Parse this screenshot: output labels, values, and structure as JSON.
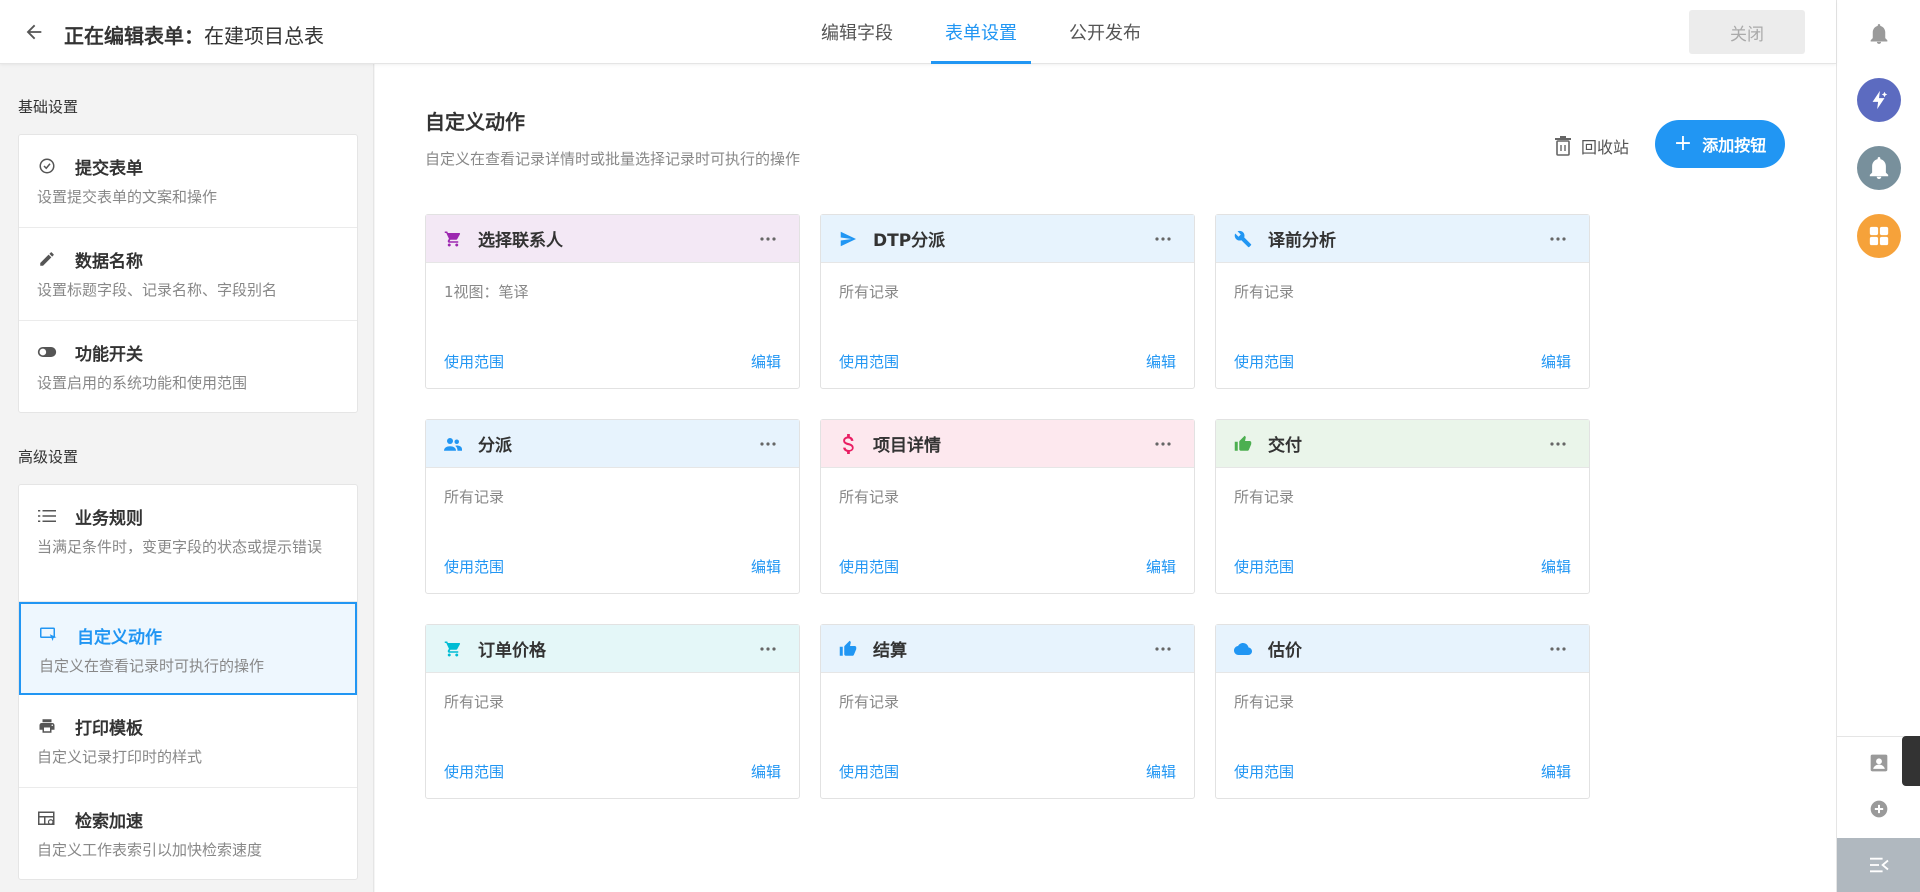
{
  "header": {
    "title_prefix": "正在编辑表单：",
    "title_name": "在建项目总表",
    "tabs": [
      {
        "label": "编辑字段"
      },
      {
        "label": "表单设置",
        "active": true
      },
      {
        "label": "公开发布"
      }
    ],
    "close_label": "关闭"
  },
  "sidebar": {
    "basic_title": "基础设置",
    "basic_items": [
      {
        "title": "提交表单",
        "desc": "设置提交表单的文案和操作",
        "icon": "check-circle-icon"
      },
      {
        "title": "数据名称",
        "desc": "设置标题字段、记录名称、字段别名",
        "icon": "pencil-icon"
      },
      {
        "title": "功能开关",
        "desc": "设置启用的系统功能和使用范围",
        "icon": "toggle-icon"
      }
    ],
    "advanced_title": "高级设置",
    "advanced_items": [
      {
        "title": "业务规则",
        "desc": "当满足条件时，变更字段的状态或提示错误",
        "icon": "list-icon"
      },
      {
        "title": "自定义动作",
        "desc": "自定义在查看记录时可执行的操作",
        "icon": "custom-action-icon",
        "selected": true
      },
      {
        "title": "打印模板",
        "desc": "自定义记录打印时的样式",
        "icon": "printer-icon"
      },
      {
        "title": "检索加速",
        "desc": "自定义工作表索引以加快检索速度",
        "icon": "index-icon"
      }
    ]
  },
  "main": {
    "title": "自定义动作",
    "desc": "自定义在查看记录详情时或批量选择记录时可执行的操作",
    "recycle_label": "回收站",
    "add_button_plus": "+",
    "add_button_label": "添加按钮",
    "cards": [
      {
        "title": "选择联系人",
        "scope": "1视图：笔译",
        "icon": "cart-icon",
        "icon_color": "#9c27b0",
        "head_bg": "#f3e8f5",
        "use_label": "使用范围",
        "edit_label": "编辑"
      },
      {
        "title": "DTP分派",
        "scope": "所有记录",
        "icon": "send-icon",
        "icon_color": "#2196f3",
        "head_bg": "#e7f3fd",
        "use_label": "使用范围",
        "edit_label": "编辑"
      },
      {
        "title": "译前分析",
        "scope": "所有记录",
        "icon": "wrench-icon",
        "icon_color": "#2196f3",
        "head_bg": "#e7f3fd",
        "use_label": "使用范围",
        "edit_label": "编辑"
      },
      {
        "title": "分派",
        "scope": "所有记录",
        "icon": "people-icon",
        "icon_color": "#2196f3",
        "head_bg": "#e7f3fd",
        "use_label": "使用范围",
        "edit_label": "编辑"
      },
      {
        "title": "项目详情",
        "scope": "所有记录",
        "icon": "dollar-icon",
        "icon_color": "#e91e63",
        "head_bg": "#fde8ee",
        "use_label": "使用范围",
        "edit_label": "编辑"
      },
      {
        "title": "交付",
        "scope": "所有记录",
        "icon": "thumbs-up-icon",
        "icon_color": "#4caf50",
        "head_bg": "#eaf5ea",
        "use_label": "使用范围",
        "edit_label": "编辑"
      },
      {
        "title": "订单价格",
        "scope": "所有记录",
        "icon": "cart-icon",
        "icon_color": "#00bcd4",
        "head_bg": "#e4f7f8",
        "use_label": "使用范围",
        "edit_label": "编辑"
      },
      {
        "title": "结算",
        "scope": "所有记录",
        "icon": "thumbs-up-icon",
        "icon_color": "#2196f3",
        "head_bg": "#e7f3fd",
        "use_label": "使用范围",
        "edit_label": "编辑"
      },
      {
        "title": "估价",
        "scope": "所有记录",
        "icon": "cloud-icon",
        "icon_color": "#2196f3",
        "head_bg": "#e7f3fd",
        "use_label": "使用范围",
        "edit_label": "编辑"
      }
    ]
  },
  "rail": {
    "colors": {
      "lightning": "#5c6bc0",
      "bell_bg": "#78909c",
      "apps": "#f6a23a",
      "bottom": "#b0b8bf"
    }
  }
}
